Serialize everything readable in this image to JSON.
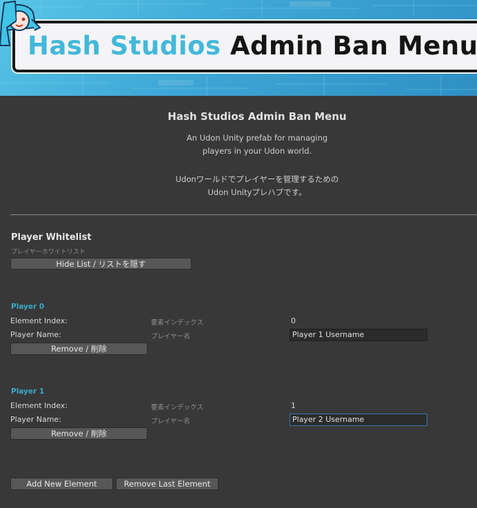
{
  "banner": {
    "brand": "Hash Studios",
    "rest": "Admin Ban Menu"
  },
  "header": {
    "title": "Hash Studios Admin Ban Menu",
    "desc_en_line1": "An Udon Unity prefab for managing",
    "desc_en_line2": "players in your Udon world.",
    "desc_jp_line1": "Udonワールドでプレイヤーを管理するための",
    "desc_jp_line2": "Udon Unityプレハブです。"
  },
  "whitelist": {
    "title": "Player Whitelist",
    "subtitle": "プレイヤーホワイトリスト",
    "toggle_label": "Hide List / リストを隠す"
  },
  "players": [
    {
      "label": "Player 0",
      "index_label": "Element Index:",
      "index_label_jp": "要素インデックス",
      "index_value": "0",
      "name_label": "Player Name:",
      "name_label_jp": "プレイヤー名",
      "name_value": "Player 1 Username",
      "remove_label": "Remove / 削除"
    },
    {
      "label": "Player 1",
      "index_label": "Element Index:",
      "index_label_jp": "要素インデックス",
      "index_value": "1",
      "name_label": "Player Name:",
      "name_label_jp": "プレイヤー名",
      "name_value": "Player 2 Username",
      "remove_label": "Remove / 削除"
    }
  ],
  "footer": {
    "add_label": "Add New Element",
    "remove_last_label": "Remove Last Element"
  },
  "colors": {
    "background": "#383838",
    "accent": "#3aa7c9",
    "brand": "#43b8d9",
    "focus_border": "#3a79bb"
  }
}
